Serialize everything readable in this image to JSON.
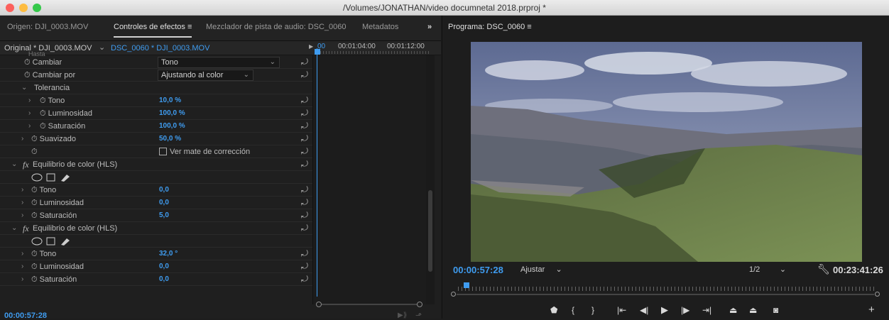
{
  "window": {
    "title": "/Volumes/JONATHAN/video documnetal 2018.prproj *"
  },
  "tabs": [
    {
      "label": "Origen: DJI_0003.MOV"
    },
    {
      "label": "Controles de efectos"
    },
    {
      "label": "Mezclador de pista de audio: DSC_0060"
    },
    {
      "label": "Metadatos"
    }
  ],
  "tabs_more": "»",
  "menu_glyph": "≡",
  "effects_header": {
    "source": "Original * DJI_0003.MOV",
    "chevron": "⌄",
    "clip": "DSC_0060 * DJI_0003.MOV",
    "cut_label": "Hasta",
    "ruler": [
      "00",
      "00:01:04:00",
      "00:01:12:00"
    ]
  },
  "rows": {
    "cambiar": {
      "label": "Cambiar",
      "value": "Tono"
    },
    "cambiar_por": {
      "label": "Cambiar por",
      "value": "Ajustando al color"
    },
    "tolerancia": {
      "label": "Tolerancia"
    },
    "tol_tono": {
      "label": "Tono",
      "value": "10,0 %"
    },
    "tol_lum": {
      "label": "Luminosidad",
      "value": "100,0 %"
    },
    "tol_sat": {
      "label": "Saturación",
      "value": "100,0 %"
    },
    "suavizado": {
      "label": "Suavizado",
      "value": "50,0 %"
    },
    "ver_mate": {
      "label": "Ver mate de corrección"
    },
    "hls1": {
      "label": "Equilibrio de color (HLS)"
    },
    "hls1_tono": {
      "label": "Tono",
      "value": "0,0"
    },
    "hls1_lum": {
      "label": "Luminosidad",
      "value": "0,0"
    },
    "hls1_sat": {
      "label": "Saturación",
      "value": "5,0"
    },
    "hls2": {
      "label": "Equilibrio de color (HLS)"
    },
    "hls2_tono": {
      "label": "Tono",
      "value": "32,0 °"
    },
    "hls2_lum": {
      "label": "Luminosidad",
      "value": "0,0"
    },
    "hls2_sat": {
      "label": "Saturación",
      "value": "0,0"
    }
  },
  "fx_symbol": "fx",
  "reset_glyph": "⤾",
  "effects_timecode": "00:00:57:28",
  "program": {
    "tab": "Programa: DSC_0060",
    "timecode_current": "00:00:57:28",
    "fit": "Ajustar",
    "resolution": "1/2",
    "timecode_duration": "00:23:41:26"
  },
  "colors": {
    "accent": "#3f9cf0",
    "panel_bg": "#1f1f1f"
  }
}
